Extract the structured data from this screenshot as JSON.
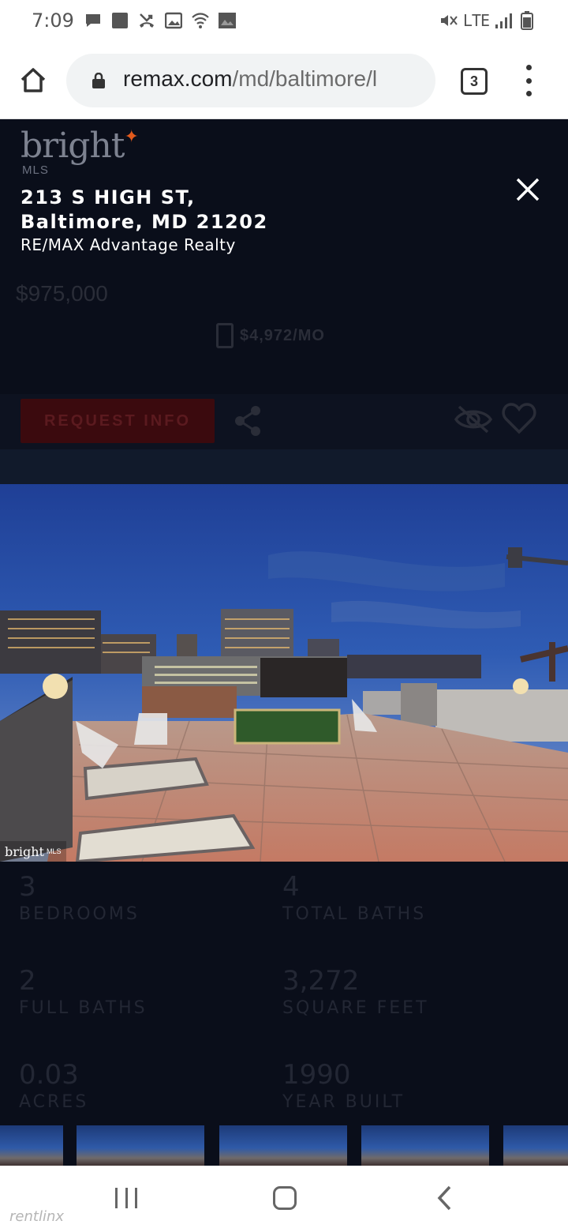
{
  "status_bar": {
    "time": "7:09",
    "network": "LTE",
    "icons_left": [
      "chat-icon",
      "square-icon",
      "missed-call-icon",
      "image-icon",
      "wifi-calling-icon",
      "photo-icon"
    ],
    "icons_right": [
      "mute-icon",
      "lte-icon",
      "signal-icon",
      "battery-icon"
    ]
  },
  "browser": {
    "url_domain": "remax.com",
    "url_path": "/md/baltimore/l",
    "tab_count": "3"
  },
  "listing": {
    "brand": "bright",
    "brand_sub": "MLS",
    "address_line1": "213 S HIGH ST,",
    "address_line2": "Baltimore, MD 21202",
    "agent": "RE/MAX Advantage Realty",
    "price": "$975,000",
    "monthly": "$4,972/MO",
    "request_button": "REQUEST INFO",
    "photo_watermark_brand": "bright",
    "photo_watermark_sub": "MLS"
  },
  "stats": [
    {
      "value": "3",
      "label": "BEDROOMS"
    },
    {
      "value": "4",
      "label": "TOTAL BATHS"
    },
    {
      "value": "2",
      "label": "FULL BATHS"
    },
    {
      "value": "3,272",
      "label": "SQUARE FEET"
    },
    {
      "value": "0.03",
      "label": "ACRES"
    },
    {
      "value": "1990",
      "label": "YEAR BUILT"
    }
  ],
  "footer_watermark": "rentlinx",
  "colors": {
    "overlay": "#0a0e1a",
    "accent": "#e25a1c",
    "request_button": "#3b0a0e"
  }
}
